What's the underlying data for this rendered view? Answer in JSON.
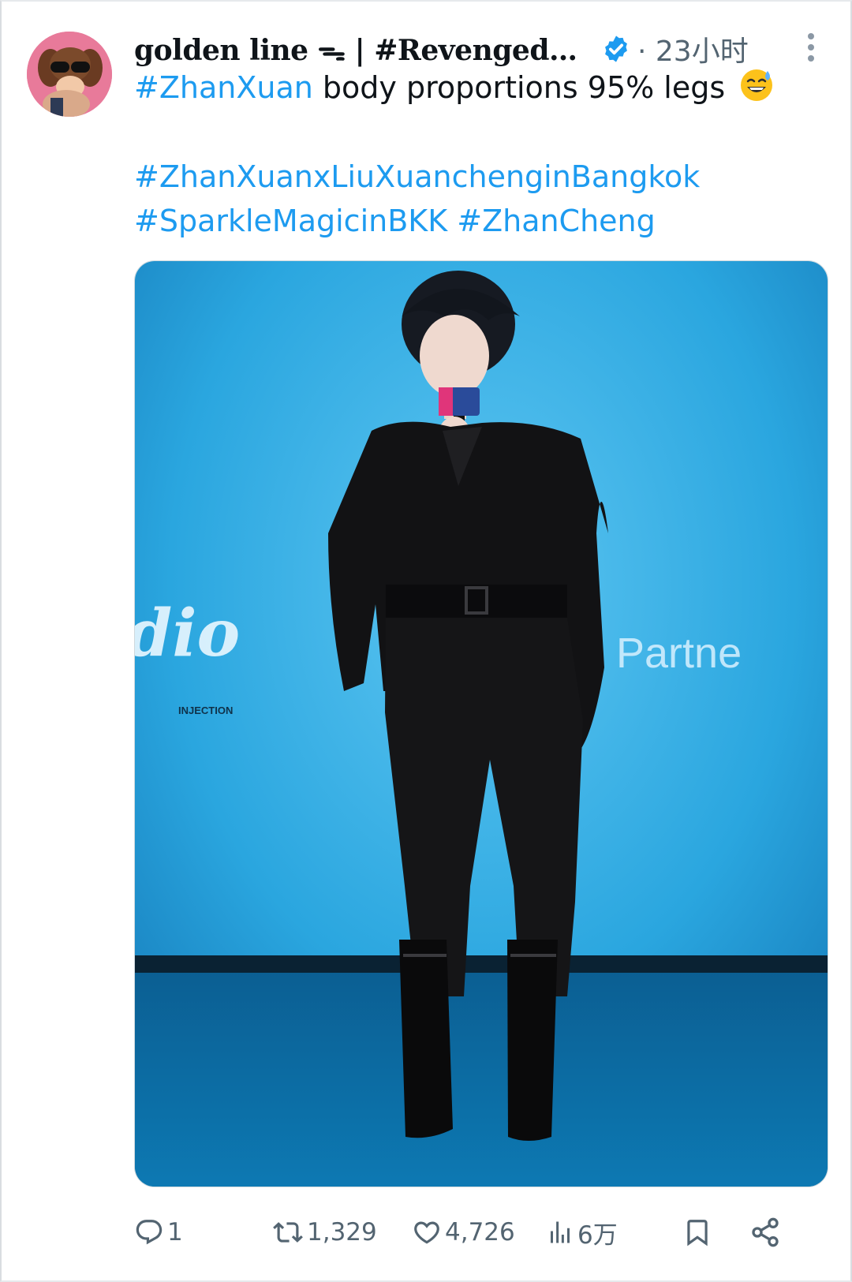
{
  "tweet": {
    "display_name": "golden line ᯓ | #RevengedL...",
    "time": "· 23小时",
    "text": {
      "hashtag_lead": "#ZhanXuan",
      "body": " body proportions 95% legs",
      "emoji": "sweat-smile-emoji",
      "hashtags_line2": "#ZhanXuanxLiuXuanchenginBangkok",
      "hashtags_line3a": "#SparkleMagicinBKK",
      "hashtags_line3b": "#ZhanCheng"
    },
    "media": {
      "backdrop_text": "Partne",
      "backdrop_script": "dio",
      "watermark": "INJECTION"
    },
    "actions": {
      "reply_count": "1",
      "retweet_count": "1,329",
      "like_count": "4,726",
      "view_count": "6万"
    }
  },
  "colors": {
    "accent": "#1d9bf0",
    "text": "#0f1419",
    "muted": "#536471"
  }
}
